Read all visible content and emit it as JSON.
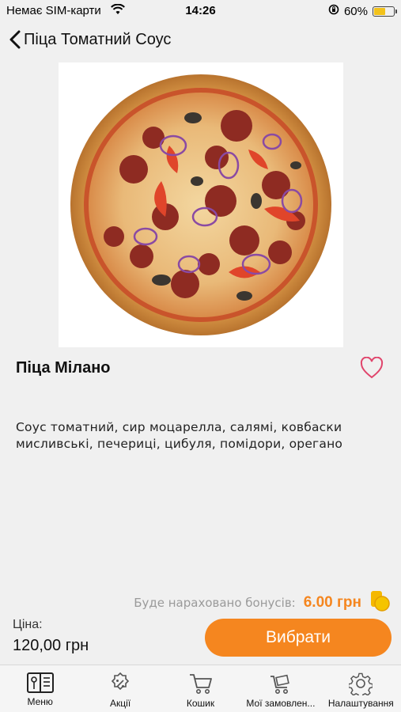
{
  "status_bar": {
    "carrier": "Немає SIM-карти",
    "time": "14:26",
    "battery_percent": "60%",
    "battery_level": 0.6
  },
  "nav": {
    "back_label": "Піца Томатний Соус"
  },
  "product": {
    "title": "Піца Мілано",
    "description": "Соус томатний, сир моцарелла, салямі, ковбаски мисливські, печериці, цибуля, помідори, орегано",
    "image_icon": "pizza-photo"
  },
  "bonus": {
    "label": "Буде нараховано бонусів:",
    "value": "6.00 грн"
  },
  "price": {
    "label": "Ціна:",
    "value": "120,00 грн"
  },
  "choose_button": "Вибрати",
  "tabs": [
    {
      "label": "Меню",
      "icon": "menu-book-icon"
    },
    {
      "label": "Акції",
      "icon": "discount-badge-icon"
    },
    {
      "label": "Кошик",
      "icon": "cart-icon"
    },
    {
      "label": "Мої замовлен...",
      "icon": "order-cart-icon"
    },
    {
      "label": "Налаштування",
      "icon": "gear-icon"
    }
  ],
  "colors": {
    "accent": "#f5861f",
    "background": "#f0f0f0",
    "heart": "#e0446b"
  }
}
